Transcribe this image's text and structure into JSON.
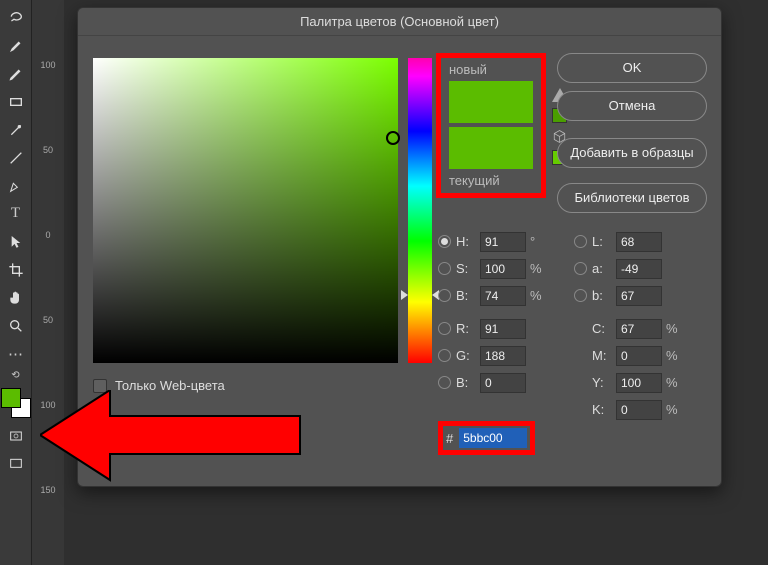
{
  "toolbar": {
    "fg_color": "#5bbc00",
    "bg_color": "#ffffff"
  },
  "ruler": {
    "marks": [
      "100",
      "50",
      "0",
      "50",
      "100",
      "150"
    ]
  },
  "dialog": {
    "title": "Палитра цветов (Основной цвет)",
    "web_only": "Только Web-цвета",
    "preview": {
      "new": "новый",
      "current": "текущий"
    },
    "buttons": {
      "ok": "OK",
      "cancel": "Отмена",
      "add": "Добавить в образцы",
      "libs": "Библиотеки цветов"
    },
    "fields": {
      "H": {
        "label": "H:",
        "v": "91",
        "u": "°"
      },
      "S": {
        "label": "S:",
        "v": "100",
        "u": "%"
      },
      "Bv": {
        "label": "B:",
        "v": "74",
        "u": "%"
      },
      "R": {
        "label": "R:",
        "v": "91",
        "u": ""
      },
      "G": {
        "label": "G:",
        "v": "188",
        "u": ""
      },
      "B2": {
        "label": "B:",
        "v": "0",
        "u": ""
      },
      "L": {
        "label": "L:",
        "v": "68",
        "u": ""
      },
      "a": {
        "label": "a:",
        "v": "-49",
        "u": ""
      },
      "b": {
        "label": "b:",
        "v": "67",
        "u": ""
      },
      "C": {
        "label": "C:",
        "v": "67",
        "u": "%"
      },
      "M": {
        "label": "M:",
        "v": "0",
        "u": "%"
      },
      "Y": {
        "label": "Y:",
        "v": "100",
        "u": "%"
      },
      "K": {
        "label": "K:",
        "v": "0",
        "u": "%"
      }
    },
    "hex": {
      "label": "#",
      "value": "5bbc00"
    }
  }
}
